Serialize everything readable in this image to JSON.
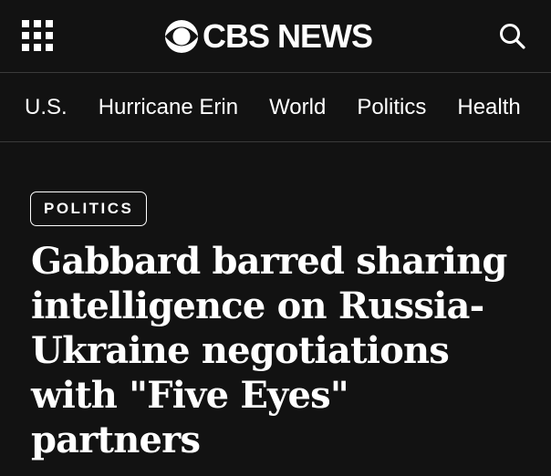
{
  "header": {
    "menu_icon": "grid-menu-icon",
    "logo_icon": "cbs-eye-icon",
    "logo_text": "CBS NEWS",
    "search_icon": "search-icon"
  },
  "nav": {
    "items": [
      {
        "label": "U.S."
      },
      {
        "label": "Hurricane Erin"
      },
      {
        "label": "World"
      },
      {
        "label": "Politics"
      },
      {
        "label": "Health"
      }
    ]
  },
  "article": {
    "category": "POLITICS",
    "headline": "Gabbard barred sharing intelligence on Russia-Ukraine negotiations with \"Five Eyes\" partners"
  },
  "colors": {
    "background": "#121212",
    "text": "#ffffff",
    "divider": "#3a3a3a"
  }
}
